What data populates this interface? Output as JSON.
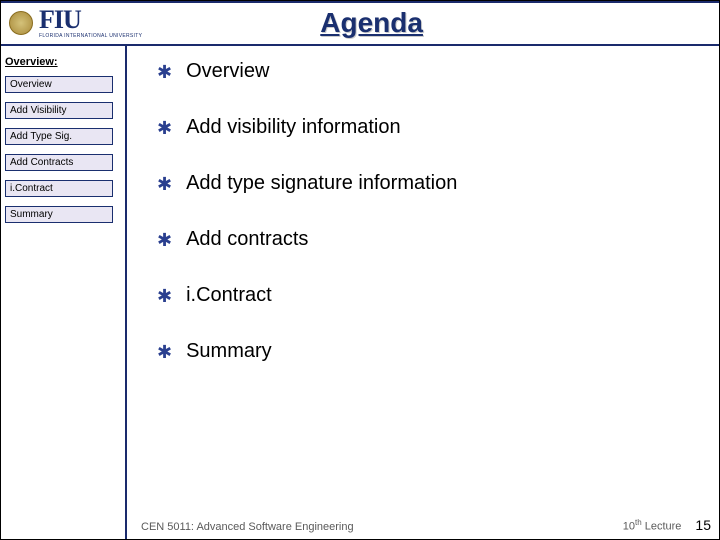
{
  "header": {
    "logo_text": "FIU",
    "logo_sub": "FLORIDA INTERNATIONAL UNIVERSITY",
    "title": "Agenda"
  },
  "sidebar": {
    "heading": "Overview:",
    "items": [
      {
        "label": "Overview"
      },
      {
        "label": "Add Visibility"
      },
      {
        "label": "Add Type Sig."
      },
      {
        "label": "Add Contracts"
      },
      {
        "label": "i.Contract"
      },
      {
        "label": "Summary"
      }
    ]
  },
  "agenda": [
    "Overview",
    "Add visibility information",
    "Add type signature information",
    "Add contracts",
    "i.Contract",
    "Summary"
  ],
  "footer": {
    "course": "CEN 5011: Advanced Software Engineering",
    "lecture_prefix": "10",
    "lecture_suffix": "th",
    "lecture_word": " Lecture",
    "page": "15"
  }
}
